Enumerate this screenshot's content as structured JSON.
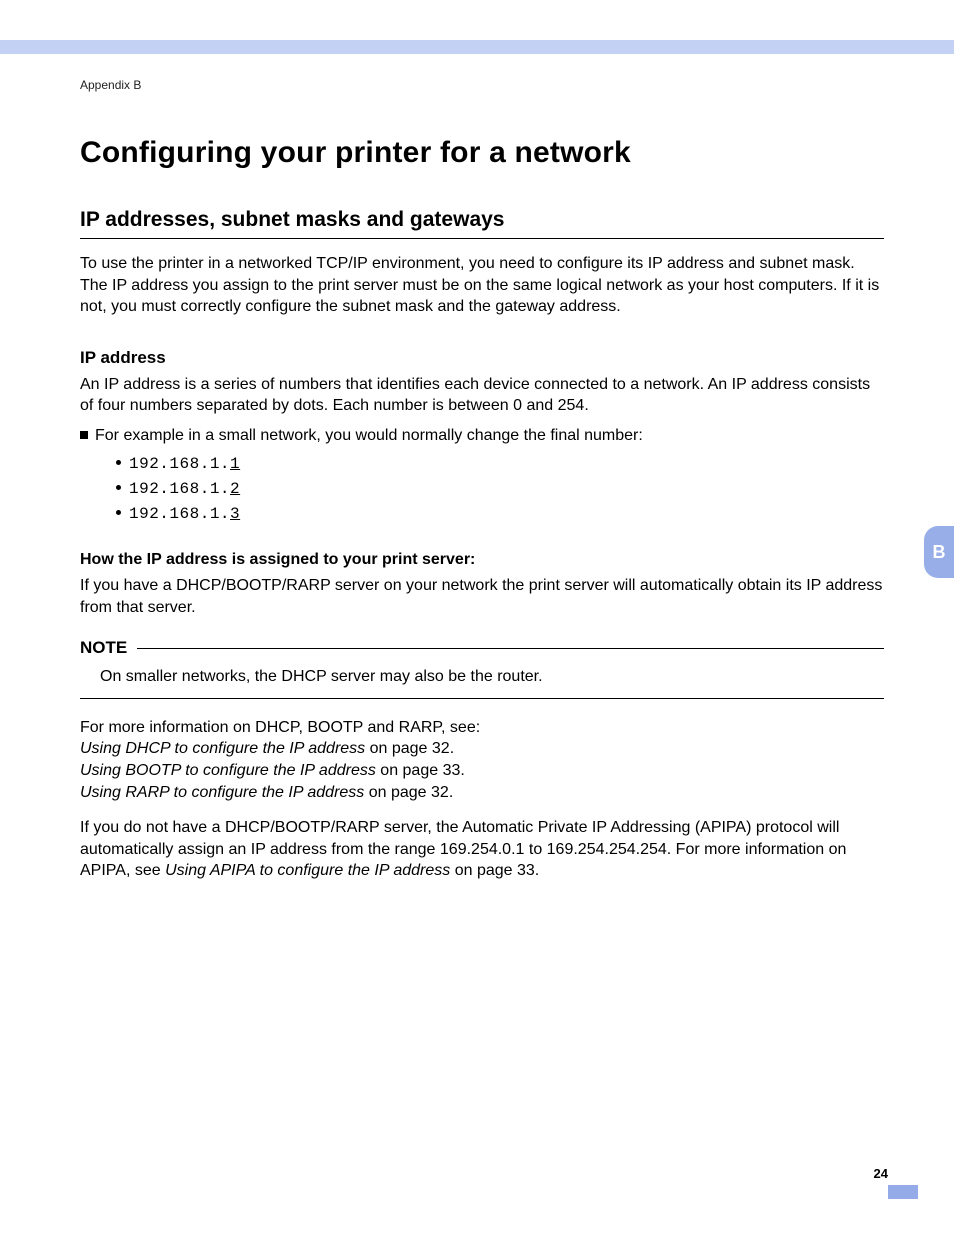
{
  "header": {
    "appendix": "Appendix B"
  },
  "title": "Configuring your printer for a network",
  "section": {
    "heading": "IP addresses, subnet masks and gateways",
    "intro": "To use the printer in a networked TCP/IP environment, you need to configure its IP address and subnet mask. The IP address you assign to the print server must be on the same logical network as your host computers. If it is not, you must correctly configure the subnet mask and the gateway address."
  },
  "ip_address": {
    "heading": "IP address",
    "desc": "An IP address is a series of numbers that identifies each device connected to a network. An IP address consists of four numbers separated by dots. Each number is between 0 and 254.",
    "example_lead": "For example in a small network, you would normally change the final number:",
    "examples": [
      {
        "prefix": "192.168.1.",
        "last": "1"
      },
      {
        "prefix": "192.168.1.",
        "last": "2"
      },
      {
        "prefix": "192.168.1.",
        "last": "3"
      }
    ]
  },
  "assign": {
    "heading": "How the IP address is assigned to your print server:",
    "body": "If you have a DHCP/BOOTP/RARP server on your network the print server will automatically obtain its IP address from that server."
  },
  "note": {
    "label": "NOTE",
    "body": "On smaller networks, the DHCP server may also be the router."
  },
  "refs": {
    "lead": "For more information on DHCP, BOOTP and RARP, see:",
    "lines": [
      {
        "italic": "Using DHCP to configure the IP address",
        "rest": " on page 32."
      },
      {
        "italic": "Using BOOTP to configure the IP address",
        "rest": " on page 33."
      },
      {
        "italic": "Using RARP to configure the IP address",
        "rest": " on page 32."
      }
    ]
  },
  "apipa": {
    "pre": "If you do not have a DHCP/BOOTP/RARP server, the Automatic Private IP Addressing (APIPA) protocol will automatically assign an IP address from the range 169.254.0.1 to 169.254.254.254. For more information on APIPA, see ",
    "italic": "Using APIPA to configure the IP address",
    "post": " on page 33."
  },
  "tab": {
    "letter": "B"
  },
  "page_number": "24"
}
